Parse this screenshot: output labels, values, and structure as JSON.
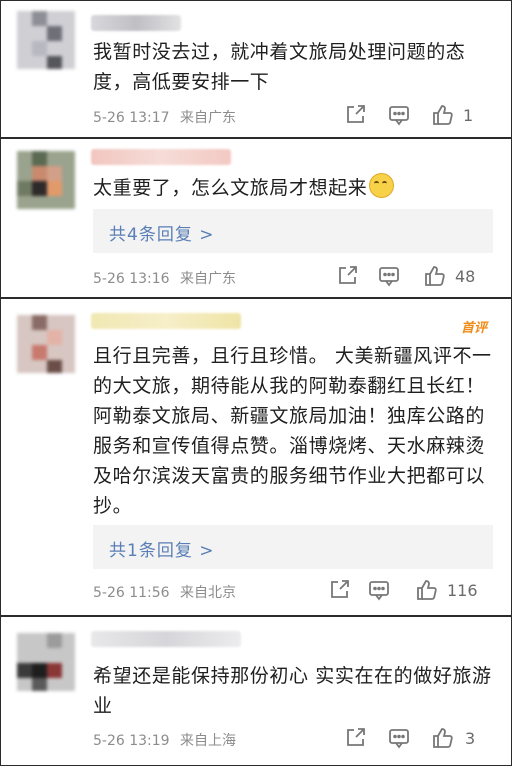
{
  "comments": [
    {
      "text": "我暂时没去过，就冲着文旅局处理问题的态度，高低要安排一下",
      "date": "5-26 13:17",
      "location": "来自广东",
      "likes": "1",
      "reply_link": "",
      "badge": ""
    },
    {
      "text": "太重要了，怎么文旅局才想起来",
      "date": "5-26 13:16",
      "location": "来自广东",
      "likes": "48",
      "reply_link": "共4条回复 >",
      "badge": ""
    },
    {
      "text": "且行且完善，且行且珍惜。 大美新疆风评不一的大文旅，期待能从我的阿勒泰翻红且长红！阿勒泰文旅局、新疆文旅局加油！独库公路的服务和宣传值得点赞。淄博烧烤、天水麻辣烫及哈尔滨泼天富贵的服务细节作业大把都可以抄。",
      "date": "5-26 11:56",
      "location": "来自北京",
      "likes": "116",
      "reply_link": "共1条回复 >",
      "badge": "首评"
    },
    {
      "text": "希望还是能保持那份初心 实实在在的做好旅游业",
      "date": "5-26 13:19",
      "location": "来自上海",
      "likes": "3",
      "reply_link": "",
      "badge": ""
    }
  ],
  "icons": {
    "share": "share-icon",
    "comment": "comment-icon",
    "like": "thumbs-up-icon",
    "emoji": "smiling-face-emoji"
  },
  "colors": {
    "reply_link": "#5a7fb6",
    "badge": "#f08c1a",
    "meta": "#8c8c8c",
    "text": "#1f1f1f",
    "reply_bg": "#f3f3f3"
  }
}
